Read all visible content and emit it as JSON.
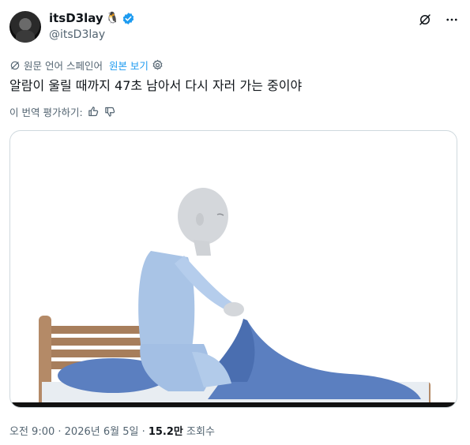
{
  "author": {
    "display_name": "itsD3lay",
    "emoji": "🐧",
    "handle": "@itsD3lay",
    "avatar_icon": "user-avatar",
    "verified_color": "#1d9bf0"
  },
  "translation": {
    "notice": "원문 언어 스페인어",
    "show_original": "원본 보기"
  },
  "tweet": {
    "text": "알람이 울릴 때까지 47초 남아서 다시 자러 가는 중이야"
  },
  "rate_translation": {
    "label": "이 번역 평가하기:"
  },
  "media": {
    "type": "video-frame"
  },
  "meta": {
    "time": "오전 9:00",
    "date": "2026년 6월 5일",
    "views_count": "15.2만",
    "views_label": "조회수"
  },
  "colors": {
    "link": "#1d9bf0",
    "secondary_text": "#536471",
    "primary_text": "#0f1419"
  }
}
